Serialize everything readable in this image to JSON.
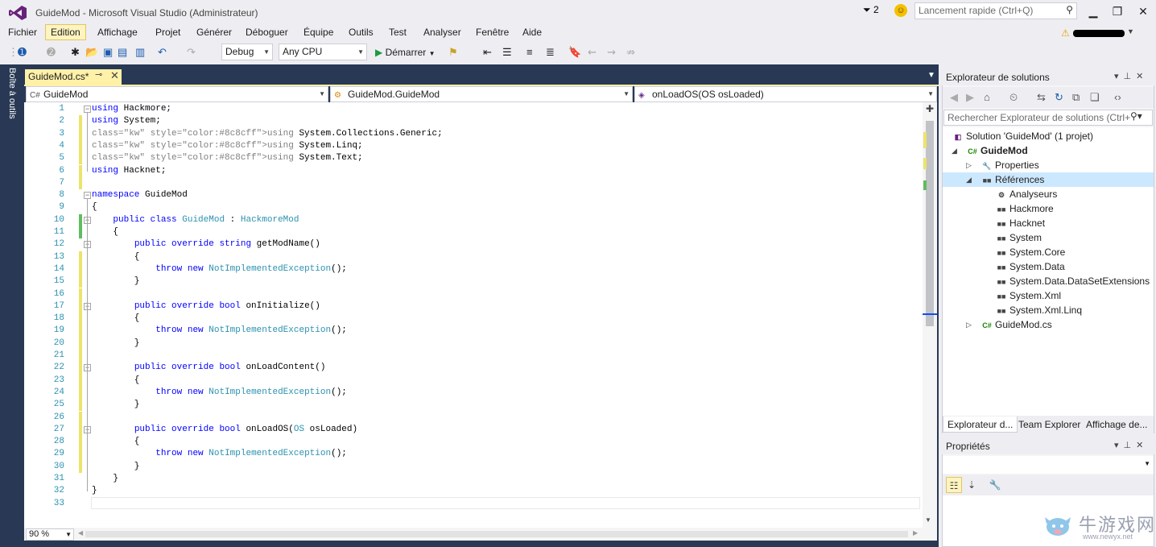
{
  "window": {
    "title": "GuideMod - Microsoft Visual Studio (Administrateur)",
    "notification_count": "2",
    "quick_launch_placeholder": "Lancement rapide (Ctrl+Q)"
  },
  "menu": [
    "Fichier",
    "Edition",
    "Affichage",
    "Projet",
    "Générer",
    "Déboguer",
    "Équipe",
    "Outils",
    "Test",
    "Analyser",
    "Fenêtre",
    "Aide"
  ],
  "toolbar": {
    "configuration": "Debug",
    "platform": "Any CPU",
    "start_label": "Démarrer"
  },
  "left_dock": {
    "toolbox_label": "Boîte à outils"
  },
  "editor": {
    "tab_label": "GuideMod.cs*",
    "nav_project": "GuideMod",
    "nav_class": "GuideMod.GuideMod",
    "nav_member": "onLoadOS(OS osLoaded)",
    "zoom": "90 %",
    "lines": [
      {
        "n": "1",
        "t": "using Hackmore;"
      },
      {
        "n": "2",
        "t": "using System;"
      },
      {
        "n": "3",
        "t": "using System.Collections.Generic;"
      },
      {
        "n": "4",
        "t": "using System.Linq;"
      },
      {
        "n": "5",
        "t": "using System.Text;"
      },
      {
        "n": "6",
        "t": "using Hacknet;"
      },
      {
        "n": "7",
        "t": ""
      },
      {
        "n": "8",
        "t": "namespace GuideMod"
      },
      {
        "n": "9",
        "t": "{"
      },
      {
        "n": "10",
        "t": "    public class GuideMod : HackmoreMod"
      },
      {
        "n": "11",
        "t": "    {"
      },
      {
        "n": "12",
        "t": "        public override string getModName()"
      },
      {
        "n": "13",
        "t": "        {"
      },
      {
        "n": "14",
        "t": "            throw new NotImplementedException();"
      },
      {
        "n": "15",
        "t": "        }"
      },
      {
        "n": "16",
        "t": ""
      },
      {
        "n": "17",
        "t": "        public override bool onInitialize()"
      },
      {
        "n": "18",
        "t": "        {"
      },
      {
        "n": "19",
        "t": "            throw new NotImplementedException();"
      },
      {
        "n": "20",
        "t": "        }"
      },
      {
        "n": "21",
        "t": ""
      },
      {
        "n": "22",
        "t": "        public override bool onLoadContent()"
      },
      {
        "n": "23",
        "t": "        {"
      },
      {
        "n": "24",
        "t": "            throw new NotImplementedException();"
      },
      {
        "n": "25",
        "t": "        }"
      },
      {
        "n": "26",
        "t": ""
      },
      {
        "n": "27",
        "t": "        public override bool onLoadOS(OS osLoaded)"
      },
      {
        "n": "28",
        "t": "        {"
      },
      {
        "n": "29",
        "t": "            throw new NotImplementedException();"
      },
      {
        "n": "30",
        "t": "        }"
      },
      {
        "n": "31",
        "t": "    }"
      },
      {
        "n": "32",
        "t": "}"
      },
      {
        "n": "33",
        "t": ""
      }
    ]
  },
  "solution_explorer": {
    "title": "Explorateur de solutions",
    "search_placeholder": "Rechercher Explorateur de solutions (Ctrl+",
    "tree": [
      {
        "label": "Solution 'GuideMod' (1 projet)",
        "icon": "solution-icon"
      },
      {
        "label": "GuideMod",
        "icon": "csharp-project-icon"
      },
      {
        "label": "Properties",
        "icon": "wrench-icon"
      },
      {
        "label": "Références",
        "icon": "references-icon"
      },
      {
        "label": "Analyseurs",
        "icon": "analyzer-icon"
      },
      {
        "label": "Hackmore",
        "icon": "reference-icon"
      },
      {
        "label": "Hacknet",
        "icon": "reference-icon"
      },
      {
        "label": "System",
        "icon": "reference-icon"
      },
      {
        "label": "System.Core",
        "icon": "reference-icon"
      },
      {
        "label": "System.Data",
        "icon": "reference-icon"
      },
      {
        "label": "System.Data.DataSetExtensions",
        "icon": "reference-icon"
      },
      {
        "label": "System.Xml",
        "icon": "reference-icon"
      },
      {
        "label": "System.Xml.Linq",
        "icon": "reference-icon"
      },
      {
        "label": "GuideMod.cs",
        "icon": "csharp-file-icon"
      }
    ],
    "tabs": [
      "Explorateur d...",
      "Team Explorer",
      "Affichage de..."
    ]
  },
  "properties": {
    "title": "Propriétés"
  },
  "watermark": {
    "text": "牛游戏网",
    "url": "www.newyx.net"
  },
  "colors": {
    "accent_tab": "#fff1a8",
    "dock": "#293955",
    "keyword": "#0000ff",
    "type": "#2b91af",
    "selection": "#cce8ff"
  }
}
